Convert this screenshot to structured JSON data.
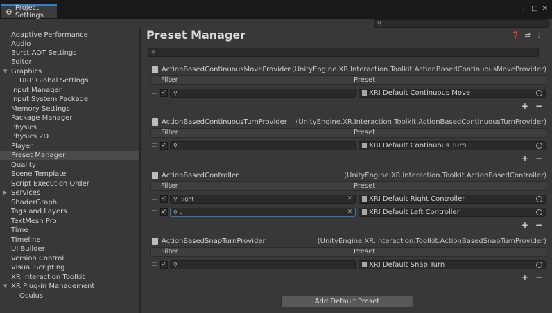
{
  "window": {
    "title": "Project Settings",
    "controls": [
      "⋮",
      "□",
      "✕"
    ]
  },
  "top_search": {
    "placeholder": ""
  },
  "sidebar": {
    "items": [
      {
        "label": "Adaptive Performance",
        "depth": 0
      },
      {
        "label": "Audio",
        "depth": 0
      },
      {
        "label": "Burst AOT Settings",
        "depth": 0
      },
      {
        "label": "Editor",
        "depth": 0
      },
      {
        "label": "Graphics",
        "depth": 0,
        "expanded": true
      },
      {
        "label": "URP Global Settings",
        "depth": 1
      },
      {
        "label": "Input Manager",
        "depth": 0
      },
      {
        "label": "Input System Package",
        "depth": 0
      },
      {
        "label": "Memory Settings",
        "depth": 0
      },
      {
        "label": "Package Manager",
        "depth": 0
      },
      {
        "label": "Physics",
        "depth": 0
      },
      {
        "label": "Physics 2D",
        "depth": 0
      },
      {
        "label": "Player",
        "depth": 0
      },
      {
        "label": "Preset Manager",
        "depth": 0,
        "selected": true
      },
      {
        "label": "Quality",
        "depth": 0
      },
      {
        "label": "Scene Template",
        "depth": 0
      },
      {
        "label": "Script Execution Order",
        "depth": 0
      },
      {
        "label": "Services",
        "depth": 0,
        "collapsed": true
      },
      {
        "label": "ShaderGraph",
        "depth": 0
      },
      {
        "label": "Tags and Layers",
        "depth": 0
      },
      {
        "label": "TextMesh Pro",
        "depth": 0
      },
      {
        "label": "Time",
        "depth": 0
      },
      {
        "label": "Timeline",
        "depth": 0
      },
      {
        "label": "UI Builder",
        "depth": 0
      },
      {
        "label": "Version Control",
        "depth": 0
      },
      {
        "label": "Visual Scripting",
        "depth": 0
      },
      {
        "label": "XR Interaction Toolkit",
        "depth": 0
      },
      {
        "label": "XR Plug-in Management",
        "depth": 0,
        "expanded": true
      },
      {
        "label": "Oculus",
        "depth": 1
      }
    ]
  },
  "main": {
    "title": "Preset Manager",
    "header_icons": [
      "help-icon",
      "settings-sliders-icon",
      "more-icon"
    ],
    "column_filter": "Filter",
    "column_preset": "Preset",
    "groups": [
      {
        "name": "ActionBasedContinuousMoveProvider",
        "type": "(UnityEngine.XR.Interaction.Toolkit.ActionBasedContinuousMoveProvider)",
        "rows": [
          {
            "filter": "",
            "preset": "XRI Default Continuous Move",
            "checked": true
          }
        ]
      },
      {
        "name": "ActionBasedContinuousTurnProvider",
        "type": "(UnityEngine.XR.Interaction.Toolkit.ActionBasedContinuousTurnProvider)",
        "rows": [
          {
            "filter": "",
            "preset": "XRI Default Continuous Turn",
            "checked": true
          }
        ]
      },
      {
        "name": "ActionBasedController",
        "type": "(UnityEngine.XR.Interaction.Toolkit.ActionBasedController)",
        "rows": [
          {
            "filter": "Right",
            "preset": "XRI Default Right Controller",
            "checked": true
          },
          {
            "filter": "L",
            "preset": "XRI Default Left Controller",
            "checked": true,
            "active": true
          }
        ]
      },
      {
        "name": "ActionBasedSnapTurnProvider",
        "type": "(UnityEngine.XR.Interaction.Toolkit.ActionBasedSnapTurnProvider)",
        "rows": [
          {
            "filter": "",
            "preset": "XRI Default Snap Turn",
            "checked": true
          }
        ]
      }
    ],
    "add_label": "+",
    "remove_label": "−",
    "add_default_button": "Add Default Preset"
  }
}
